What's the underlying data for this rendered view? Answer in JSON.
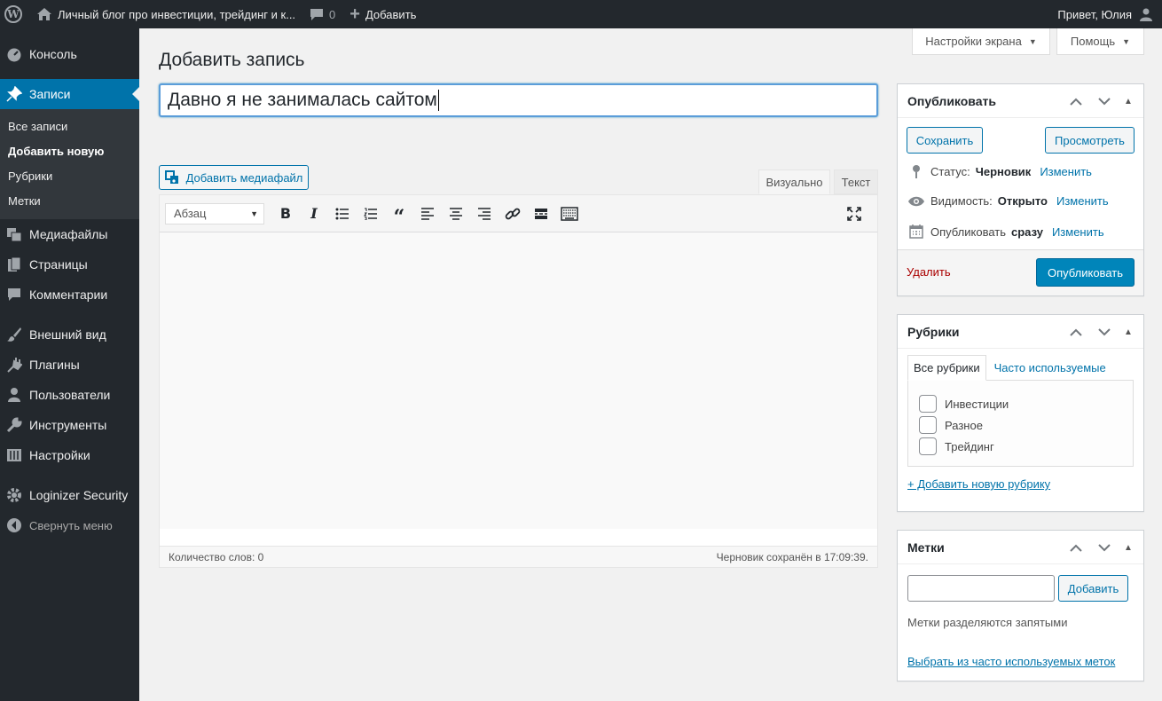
{
  "adminbar": {
    "site_title": "Личный блог про инвестиции, трейдинг и к...",
    "comments_count": "0",
    "add_new": "Добавить",
    "greeting": "Привет, Юлия"
  },
  "sidebar": {
    "items": [
      {
        "label": "Консоль"
      },
      {
        "label": "Записи"
      },
      {
        "label": "Медиафайлы"
      },
      {
        "label": "Страницы"
      },
      {
        "label": "Комментарии"
      },
      {
        "label": "Внешний вид"
      },
      {
        "label": "Плагины"
      },
      {
        "label": "Пользователи"
      },
      {
        "label": "Инструменты"
      },
      {
        "label": "Настройки"
      },
      {
        "label": "Loginizer Security"
      },
      {
        "label": "Свернуть меню"
      }
    ],
    "submenu": [
      "Все записи",
      "Добавить новую",
      "Рубрики",
      "Метки"
    ]
  },
  "screen": {
    "options": "Настройки экрана",
    "help": "Помощь"
  },
  "editor": {
    "page_title": "Добавить запись",
    "post_title": "Давно я не занималась сайтом",
    "add_media": "Добавить медиафайл",
    "tab_visual": "Визуально",
    "tab_text": "Текст",
    "format": "Абзац",
    "word_count": "Количество слов: 0",
    "draft_saved": "Черновик сохранён в 17:09:39."
  },
  "publish": {
    "title": "Опубликовать",
    "save": "Сохранить",
    "preview": "Просмотреть",
    "status_label": "Статус:",
    "status_value": "Черновик",
    "visibility_label": "Видимость:",
    "visibility_value": "Открыто",
    "publish_label": "Опубликовать",
    "publish_value": "сразу",
    "edit": "Изменить",
    "delete": "Удалить",
    "publish_btn": "Опубликовать"
  },
  "categories": {
    "title": "Рубрики",
    "tab_all": "Все рубрики",
    "tab_popular": "Часто используемые",
    "items": [
      "Инвестиции",
      "Разное",
      "Трейдинг"
    ],
    "add_new": "+ Добавить новую рубрику"
  },
  "tags": {
    "title": "Метки",
    "add": "Добавить",
    "hint": "Метки разделяются запятыми",
    "choose_popular": "Выбрать из часто используемых меток"
  },
  "colors": {
    "admin_dark": "#23282d",
    "accent": "#0073aa",
    "primary_button": "#0085ba"
  }
}
